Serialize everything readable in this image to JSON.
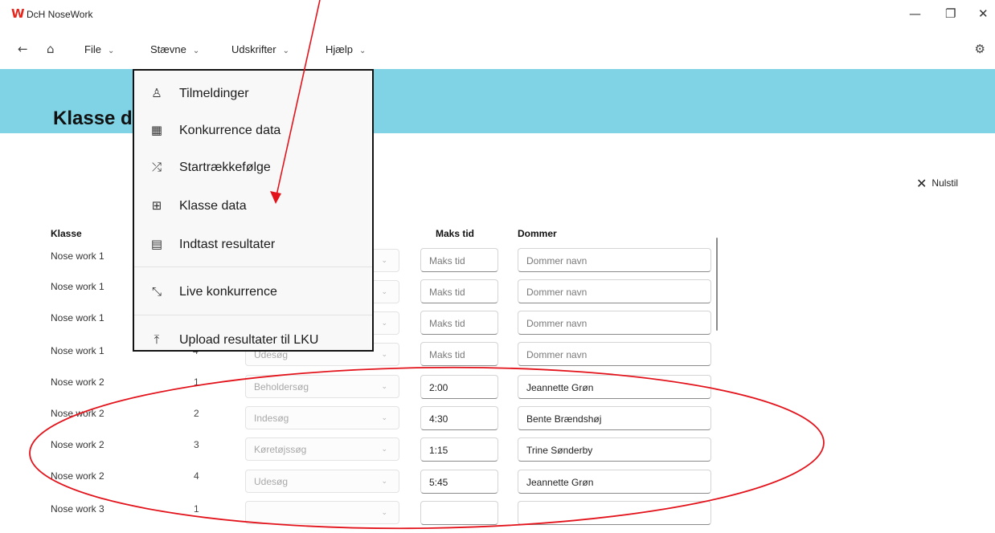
{
  "window": {
    "logo_glyph": "W",
    "title": "DcH NoseWork",
    "minimize_glyph": "—",
    "restore_glyph": "❐",
    "close_glyph": "✕"
  },
  "nav": {
    "back_glyph": "←",
    "home_glyph": "⌂",
    "settings_glyph": "⚙"
  },
  "menu": [
    {
      "label": "File"
    },
    {
      "label": "Stævne"
    },
    {
      "label": "Udskrifter"
    },
    {
      "label": "Hjælp"
    }
  ],
  "menu_chevron": "⌄",
  "dropdown": [
    {
      "icon": "people-list-icon",
      "glyph": "♙",
      "label": "Tilmeldinger"
    },
    {
      "icon": "calendar-icon",
      "glyph": "▦",
      "label": "Konkurrence data"
    },
    {
      "icon": "shuffle-icon",
      "glyph": "⤮",
      "label": "Startrækkefølge"
    },
    {
      "icon": "grid-icon",
      "glyph": "⊞",
      "label": "Klasse data"
    },
    {
      "icon": "calculator-icon",
      "glyph": "▤",
      "label": "Indtast resultater"
    },
    {
      "icon": "collapse-arrows-icon",
      "glyph": "⤡",
      "label": "Live konkurrence"
    },
    {
      "icon": "upload-icon",
      "glyph": "⤒",
      "label": "Upload resultater til LKU"
    }
  ],
  "page": {
    "title": "Klasse d",
    "reset_glyph": "✕",
    "reset_label": "Nulstil"
  },
  "table": {
    "headers": {
      "klasse": "Klasse",
      "maks_tid": "Maks tid",
      "dommer": "Dommer"
    },
    "select_chevron": "⌄",
    "rows": [
      {
        "klasse": "Nose work 1",
        "nr": "",
        "search": "",
        "maks_tid": "",
        "maks_placeholder": "Maks tid",
        "dommer": "",
        "dommer_placeholder": "Dommer navn"
      },
      {
        "klasse": "Nose work 1",
        "nr": "",
        "search": "",
        "maks_tid": "",
        "maks_placeholder": "Maks tid",
        "dommer": "",
        "dommer_placeholder": "Dommer navn"
      },
      {
        "klasse": "Nose work 1",
        "nr": "",
        "search": "",
        "maks_tid": "",
        "maks_placeholder": "Maks tid",
        "dommer": "",
        "dommer_placeholder": "Dommer navn"
      },
      {
        "klasse": "Nose work 1",
        "nr": "4",
        "search": "Udesøg",
        "maks_tid": "",
        "maks_placeholder": "Maks tid",
        "dommer": "",
        "dommer_placeholder": "Dommer navn"
      },
      {
        "klasse": "Nose work 2",
        "nr": "1",
        "search": "Beholdersøg",
        "maks_tid": "2:00",
        "maks_placeholder": "",
        "dommer": "Jeannette Grøn",
        "dommer_placeholder": ""
      },
      {
        "klasse": "Nose work 2",
        "nr": "2",
        "search": "Indesøg",
        "maks_tid": "4:30",
        "maks_placeholder": "",
        "dommer": "Bente Brændshøj",
        "dommer_placeholder": ""
      },
      {
        "klasse": "Nose work 2",
        "nr": "3",
        "search": "Køretøjssøg",
        "maks_tid": "1:15",
        "maks_placeholder": "",
        "dommer": "Trine Sønderby",
        "dommer_placeholder": ""
      },
      {
        "klasse": "Nose work 2",
        "nr": "4",
        "search": "Udesøg",
        "maks_tid": "5:45",
        "maks_placeholder": "",
        "dommer": "Jeannette Grøn",
        "dommer_placeholder": ""
      },
      {
        "klasse": "Nose work 3",
        "nr": "1",
        "search": "",
        "maks_tid": "",
        "maks_placeholder": "",
        "dommer": "",
        "dommer_placeholder": ""
      }
    ]
  },
  "annotation_color": "#e3131b"
}
